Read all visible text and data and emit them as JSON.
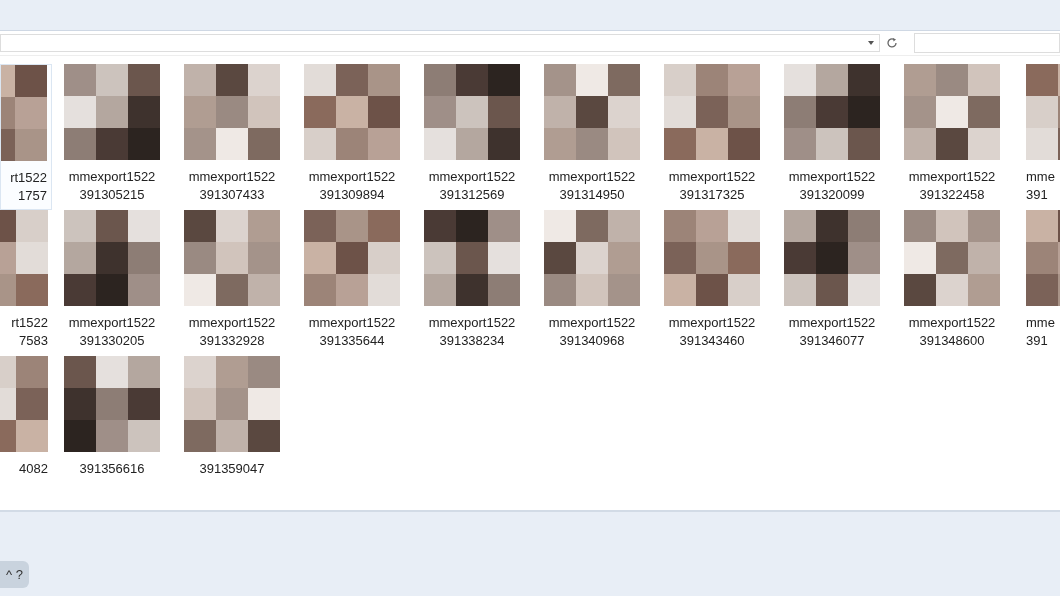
{
  "file_grid": {
    "rows": [
      {
        "items": [
          {
            "lines": [
              "rt1522",
              "1757"
            ],
            "selected": true
          },
          {
            "lines": [
              "mmexport1522",
              "391305215"
            ],
            "selected": false
          },
          {
            "lines": [
              "mmexport1522",
              "391307433"
            ],
            "selected": false
          },
          {
            "lines": [
              "mmexport1522",
              "391309894"
            ],
            "selected": false
          },
          {
            "lines": [
              "mmexport1522",
              "391312569"
            ],
            "selected": false
          },
          {
            "lines": [
              "mmexport1522",
              "391314950"
            ],
            "selected": false
          },
          {
            "lines": [
              "mmexport1522",
              "391317325"
            ],
            "selected": false
          },
          {
            "lines": [
              "mmexport1522",
              "391320099"
            ],
            "selected": false
          },
          {
            "lines": [
              "mmexport1522",
              "391322458"
            ],
            "selected": false
          },
          {
            "lines": [
              "mme",
              "391"
            ],
            "selected": false
          }
        ]
      },
      {
        "items": [
          {
            "lines": [
              "rt1522",
              "7583"
            ],
            "selected": false
          },
          {
            "lines": [
              "mmexport1522",
              "391330205"
            ],
            "selected": false
          },
          {
            "lines": [
              "mmexport1522",
              "391332928"
            ],
            "selected": false
          },
          {
            "lines": [
              "mmexport1522",
              "391335644"
            ],
            "selected": false
          },
          {
            "lines": [
              "mmexport1522",
              "391338234"
            ],
            "selected": false
          },
          {
            "lines": [
              "mmexport1522",
              "391340968"
            ],
            "selected": false
          },
          {
            "lines": [
              "mmexport1522",
              "391343460"
            ],
            "selected": false
          },
          {
            "lines": [
              "mmexport1522",
              "391346077"
            ],
            "selected": false
          },
          {
            "lines": [
              "mmexport1522",
              "391348600"
            ],
            "selected": false
          },
          {
            "lines": [
              "mme",
              "391"
            ],
            "selected": false
          }
        ]
      },
      {
        "items": [
          {
            "lines": [
              "4082"
            ],
            "selected": false
          },
          {
            "lines": [
              "391356616"
            ],
            "selected": false
          },
          {
            "lines": [
              "391359047"
            ],
            "selected": false
          }
        ]
      }
    ]
  },
  "bottom_bar": {
    "button": "^ ?"
  }
}
